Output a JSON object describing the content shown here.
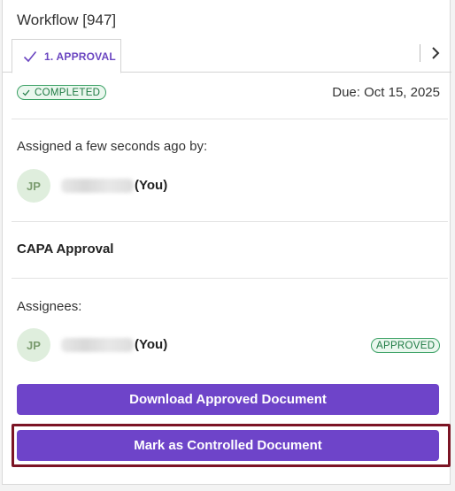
{
  "header": {
    "title": "Workflow [947]"
  },
  "tabs": [
    {
      "label": "1. APPROVAL",
      "icon": "check-icon",
      "active": true
    }
  ],
  "tab_nav": {
    "icon": "chevron-right-icon"
  },
  "status": {
    "badge": "COMPLETED",
    "due": "Due: Oct 15, 2025"
  },
  "assignment": {
    "label": "Assigned a few seconds ago by:",
    "user": {
      "initials": "JP",
      "suffix": "(You)"
    }
  },
  "step": {
    "title": "CAPA Approval"
  },
  "assignees": {
    "label": "Assignees:",
    "items": [
      {
        "initials": "JP",
        "suffix": "(You)",
        "status": "APPROVED"
      }
    ]
  },
  "actions": {
    "download_label": "Download Approved Document",
    "controlled_label": "Mark as Controlled Document"
  },
  "colors": {
    "accent": "#6e44c9",
    "success": "#3aa064",
    "highlight": "#7b1424"
  }
}
